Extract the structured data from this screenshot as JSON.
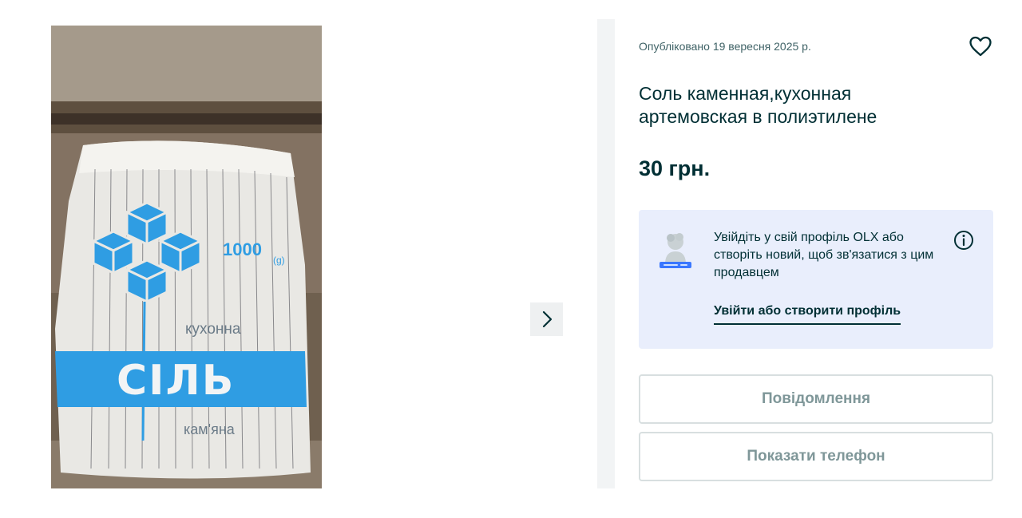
{
  "gallery": {
    "photo": {
      "alt": "Пакет солі",
      "bag_text": {
        "weight": "1000",
        "unit": "(g)",
        "line1": "кухонна",
        "brand": "СІЛЬ",
        "line2": "кам'яна"
      }
    },
    "next_icon": "chevron-right-icon"
  },
  "listing": {
    "published": "Опубліковано 19 вересня 2025 р.",
    "favorite_icon": "heart-outline-icon",
    "title": "Соль каменная,кухонная артемовская в полиэтилене",
    "price": "30 грн."
  },
  "login_card": {
    "text": "Увійдіть у свій профіль OLX або створіть новий, щоб зв'язатися з цим продавцем",
    "link": "Увійти або створити профіль",
    "info_icon": "info-icon",
    "avatar_icon": "profile-illustration-icon"
  },
  "actions": {
    "message_label": "Повідомлення",
    "phone_label": "Показати телефон"
  },
  "colors": {
    "text_dark": "#002f34",
    "text_muted": "#406367",
    "card_bg": "#e9eefc",
    "button_border": "#d8dfe0",
    "button_text": "#7f9799",
    "salt_blue": "#2f9de3"
  }
}
